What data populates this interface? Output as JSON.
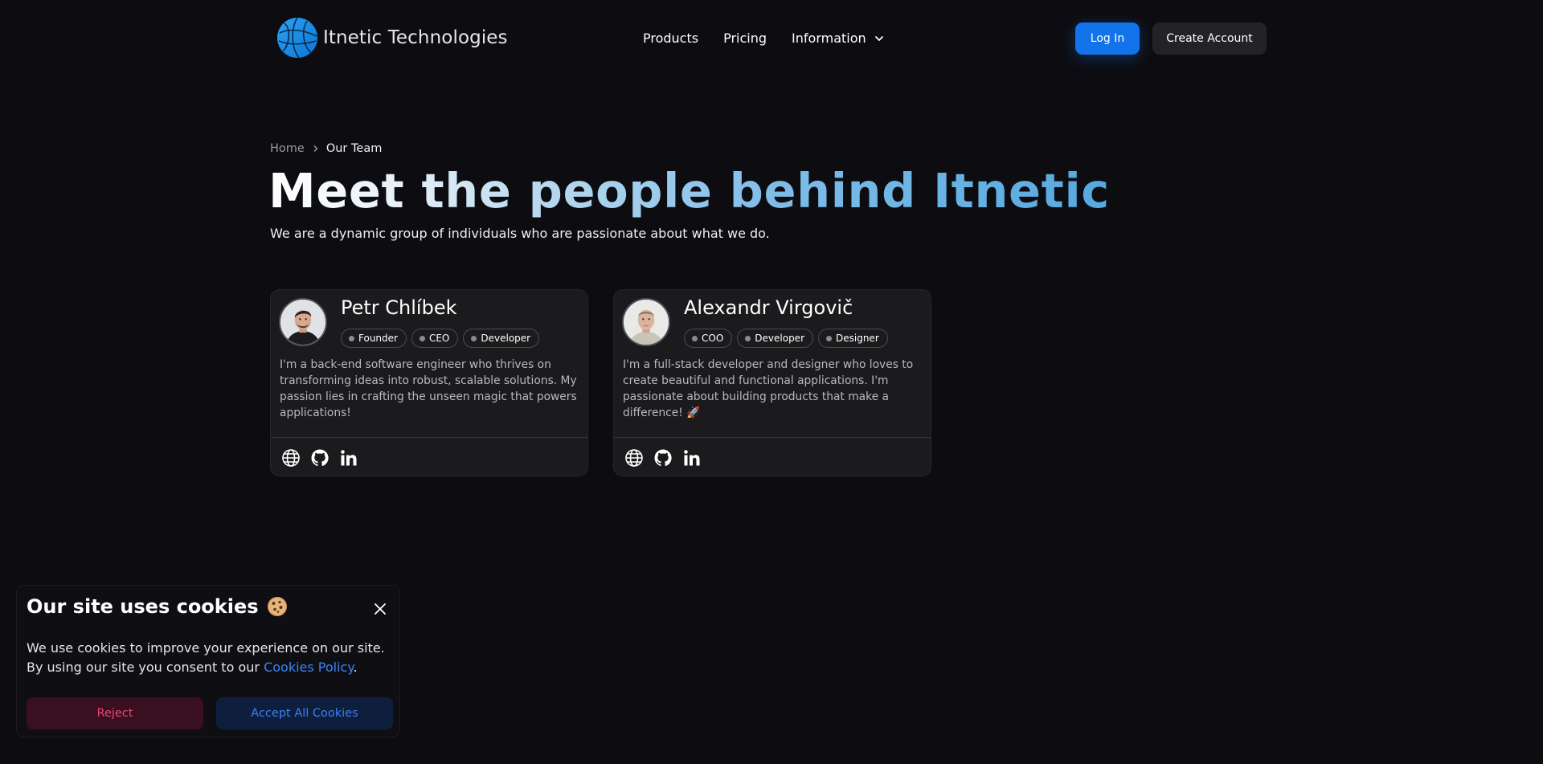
{
  "header": {
    "brand": "Itnetic Technologies",
    "nav": {
      "products": "Products",
      "pricing": "Pricing",
      "information": "Information"
    },
    "login_label": "Log In",
    "create_account_label": "Create Account"
  },
  "breadcrumb": {
    "home": "Home",
    "current": "Our Team"
  },
  "hero": {
    "title": "Meet the people behind Itnetic",
    "subtitle": "We are a dynamic group of individuals who are passionate about what we do."
  },
  "team": [
    {
      "name": "Petr Chlíbek",
      "tags": [
        "Founder",
        "CEO",
        "Developer"
      ],
      "bio": "I'm a back-end software engineer who thrives on transforming ideas into robust, scalable solutions. My passion lies in crafting the unseen magic that powers applications!",
      "socials": [
        "globe-icon",
        "github-icon",
        "linkedin-icon"
      ]
    },
    {
      "name": "Alexandr Virgovič",
      "tags": [
        "COO",
        "Developer",
        "Designer"
      ],
      "bio": "I'm a full-stack developer and designer who loves to create beautiful and functional applications. I'm passionate about building products that make a difference! 🚀",
      "socials": [
        "globe-icon",
        "github-icon",
        "linkedin-icon"
      ]
    }
  ],
  "cookie": {
    "title": "Our site uses cookies",
    "text": "We use cookies to improve your experience on our site. By using our site you consent to our",
    "link": "Cookies Policy",
    "period": ".",
    "reject_label": "Reject",
    "accept_label": "Accept All Cookies"
  },
  "colors": {
    "background": "#0d0d11",
    "accent": "#1273ea",
    "card": "#1b1b1e",
    "reject_text": "#e4477a",
    "accept_text": "#3c7ff0"
  }
}
